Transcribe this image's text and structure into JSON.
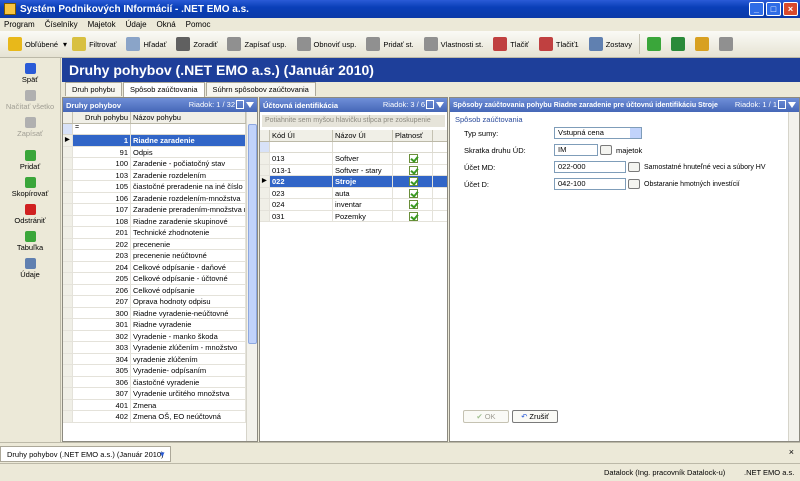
{
  "window": {
    "title": "Systém Podnikových INformácií - .NET EMO a.s.",
    "buttons": [
      "_",
      "□",
      "×"
    ]
  },
  "menu": [
    "Program",
    "Číselníky",
    "Majetok",
    "Údaje",
    "Okná",
    "Pomoc"
  ],
  "toolbar": {
    "items": [
      {
        "label": "Obľúbené",
        "icon": "star-icon",
        "color": "#e8b81a"
      },
      {
        "label": "Filtrovať",
        "icon": "filter-icon",
        "color": "#d8c040"
      },
      {
        "label": "Hľadať",
        "icon": "magnifier-icon",
        "color": "#8aa4c8"
      },
      {
        "label": "Zoradiť",
        "icon": "sort-az-icon",
        "color": "#606060"
      },
      {
        "label": "Zapísať usp.",
        "icon": "save-layout-icon",
        "color": "#909090"
      },
      {
        "label": "Obnoviť usp.",
        "icon": "restore-layout-icon",
        "color": "#909090"
      },
      {
        "label": "Pridať st.",
        "icon": "add-column-icon",
        "color": "#909090"
      },
      {
        "label": "Vlastnosti st.",
        "icon": "column-properties-icon",
        "color": "#909090"
      },
      {
        "label": "Tlačiť",
        "icon": "printer-icon",
        "color": "#c04040"
      },
      {
        "label": "Tlačiť1",
        "icon": "printer-alt-icon",
        "color": "#c04040"
      },
      {
        "label": "Zostavy",
        "icon": "reports-icon",
        "color": "#6080b0"
      }
    ],
    "extra_icons": [
      "calendar-icon",
      "export-icon",
      "import-icon",
      "grid-icon"
    ]
  },
  "sidebar": {
    "items": [
      {
        "label": "Späť",
        "icon": "back-arrow-icon",
        "color": "#2a5bd7",
        "enabled": true
      },
      {
        "label": "Načítať všetko",
        "icon": "load-all-icon",
        "color": "#b0b0b0",
        "enabled": false
      },
      {
        "label": "Zapísať",
        "icon": "save-down-icon",
        "color": "#b0b0b0",
        "enabled": false
      },
      {
        "label": "Pridať",
        "icon": "plus-icon",
        "color": "#3aa63a",
        "enabled": true
      },
      {
        "label": "Skopírovať",
        "icon": "copy-icon",
        "color": "#3aa63a",
        "enabled": true
      },
      {
        "label": "Odstrániť",
        "icon": "delete-x-icon",
        "color": "#d02020",
        "enabled": true
      },
      {
        "label": "Tabuľka",
        "icon": "checkmark-icon",
        "color": "#3aa63a",
        "enabled": true
      },
      {
        "label": "Údaje",
        "icon": "data-icon",
        "color": "#6080b0",
        "enabled": true
      }
    ]
  },
  "header": {
    "title": "Druhy pohybov (.NET EMO a.s.) (Január 2010)"
  },
  "tabs": [
    {
      "label": "Druh pohybu",
      "active": false
    },
    {
      "label": "Spôsob zaúčtovania",
      "active": true
    },
    {
      "label": "Súhrn spôsobov zaúčtovania",
      "active": false
    }
  ],
  "left_panel": {
    "title": "Druhy pohybov",
    "row_info": "Riadok: 1 / 32",
    "columns": [
      "Druh pohybu",
      "Názov pohybu"
    ],
    "filter_value": "=",
    "rows": [
      {
        "code": "1",
        "name": "Riadne zaradenie",
        "selected": true
      },
      {
        "code": "91",
        "name": "Odpis",
        "selected": false
      },
      {
        "code": "100",
        "name": "Zaradenie - počiatočný stav",
        "selected": false
      },
      {
        "code": "103",
        "name": "Zaradenie rozdelením",
        "selected": false
      },
      {
        "code": "105",
        "name": "čiastočné preradenie na iné číslo",
        "selected": false
      },
      {
        "code": "106",
        "name": "Zaradenie rozdelením-množstva",
        "selected": false
      },
      {
        "code": "107",
        "name": "Zaradenie preradením-množstva  na",
        "selected": false
      },
      {
        "code": "108",
        "name": "Riadne zaradenie skupinové",
        "selected": false
      },
      {
        "code": "201",
        "name": "Technické zhodnotenie",
        "selected": false
      },
      {
        "code": "202",
        "name": "precenenie",
        "selected": false
      },
      {
        "code": "203",
        "name": "precenenie neúčtovné",
        "selected": false
      },
      {
        "code": "204",
        "name": "Celkové odpísanie - daňové",
        "selected": false
      },
      {
        "code": "205",
        "name": "Celkové odpísanie - účtovné",
        "selected": false
      },
      {
        "code": "206",
        "name": "Celkové odpísanie",
        "selected": false
      },
      {
        "code": "207",
        "name": "Oprava hodnoty odpisu",
        "selected": false
      },
      {
        "code": "300",
        "name": "Riadne vyradenie-neúčtovné",
        "selected": false
      },
      {
        "code": "301",
        "name": "Riadne vyradenie",
        "selected": false
      },
      {
        "code": "302",
        "name": "Vyradenie - manko škoda",
        "selected": false
      },
      {
        "code": "303",
        "name": "Vyradenie zlúčením - množstvo",
        "selected": false
      },
      {
        "code": "304",
        "name": "vyradenie zlúčením",
        "selected": false
      },
      {
        "code": "305",
        "name": "Vyradenie- odpísaním",
        "selected": false
      },
      {
        "code": "306",
        "name": "čiastočné vyradenie",
        "selected": false
      },
      {
        "code": "307",
        "name": "Vyradenie určitého množstva",
        "selected": false
      },
      {
        "code": "401",
        "name": "Zmena",
        "selected": false
      },
      {
        "code": "402",
        "name": "Zmena OŠ, EO neúčtovná",
        "selected": false
      }
    ]
  },
  "middle_panel": {
    "title": "Účtovná identifikácia",
    "row_info": "Riadok: 3 / 6",
    "hint": "Potiahnite sem myšou hlavičku stĺpca pre zoskupenie",
    "columns": [
      "Kód ÚI",
      "Názov ÚI",
      "Platnosť"
    ],
    "rows": [
      {
        "code": "013",
        "name": "Softver",
        "valid": true,
        "selected": false
      },
      {
        "code": "013-1",
        "name": "Softver - stary",
        "valid": true,
        "selected": false
      },
      {
        "code": "022",
        "name": "Stroje",
        "valid": true,
        "selected": true
      },
      {
        "code": "023",
        "name": "auta",
        "valid": true,
        "selected": false
      },
      {
        "code": "024",
        "name": "inventar",
        "valid": true,
        "selected": false
      },
      {
        "code": "031",
        "name": "Pozemky",
        "valid": true,
        "selected": false
      }
    ]
  },
  "right_panel": {
    "title": "Spôsoby zaúčtovania pohybu Riadne zaradenie pre účtovnú identifikáciu Stroje",
    "row_info": "Riadok: 1 / 1",
    "group_label": "Spôsob zaúčtovania",
    "fields": {
      "typ_sumy": {
        "label": "Typ sumy:",
        "value": "Vstupná cena"
      },
      "skratka": {
        "label": "Skratka druhu ÚD:",
        "value": "IM",
        "desc": "majetok"
      },
      "ucet_md": {
        "label": "Účet MD:",
        "value": "022-000",
        "desc": "Samostatné hnuteľné veci a súbory HV"
      },
      "ucet_d": {
        "label": "Účet D:",
        "value": "042-100",
        "desc": "Obstaranie hmotných investícií"
      }
    },
    "ok_label": "OK",
    "cancel_label": "Zrušiť"
  },
  "bottom_tab": {
    "label": "Druhy pohybov (.NET EMO a.s.) (Január 2010)"
  },
  "status": {
    "user": "Datalock (Ing. pracovník Datalock-u)",
    "company": ".NET EMO a.s."
  }
}
